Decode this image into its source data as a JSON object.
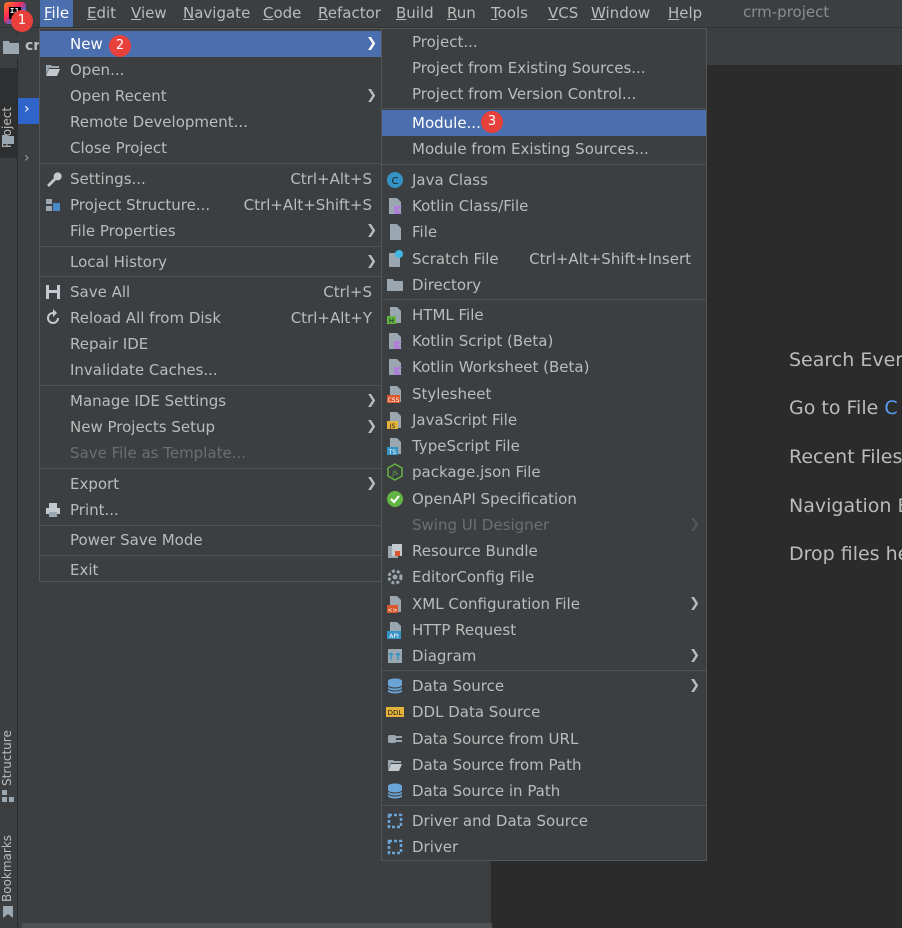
{
  "window": {
    "title": "crm-project",
    "project_short": "crm"
  },
  "menubar": [
    {
      "label": "File",
      "u": "F",
      "rest": "ile"
    },
    {
      "label": "Edit",
      "u": "E",
      "rest": "dit"
    },
    {
      "label": "View",
      "u": "V",
      "rest": "iew"
    },
    {
      "label": "Navigate",
      "u": "N",
      "rest": "avigate"
    },
    {
      "label": "Code",
      "u": "C",
      "rest": "ode"
    },
    {
      "label": "Refactor",
      "u": "R",
      "rest": "efactor"
    },
    {
      "label": "Build",
      "u": "B",
      "rest": "uild"
    },
    {
      "label": "Run",
      "u": "R",
      "rest": "un"
    },
    {
      "label": "Tools",
      "u": "T",
      "rest": "ools"
    },
    {
      "label": "VCS",
      "u": "V",
      "rest": "CS"
    },
    {
      "label": "Window",
      "u": "W",
      "rest": "indow"
    },
    {
      "label": "Help",
      "u": "H",
      "rest": "elp"
    }
  ],
  "badges": [
    "1",
    "2",
    "3"
  ],
  "left_tabs": {
    "project": "Project",
    "structure": "Structure",
    "bookmarks": "Bookmarks"
  },
  "file_menu": [
    {
      "label": "New",
      "icon": "",
      "arrow": true
    },
    {
      "label": "Open...",
      "icon": "folder-open-icon"
    },
    {
      "label": "Open Recent",
      "arrow": true
    },
    {
      "label": "Remote Development..."
    },
    {
      "label": "Close Project"
    },
    {
      "label": "Settings...",
      "icon": "wrench-icon",
      "shortcut": "Ctrl+Alt+S"
    },
    {
      "label": "Project Structure...",
      "icon": "project-structure-icon",
      "shortcut": "Ctrl+Alt+Shift+S"
    },
    {
      "label": "File Properties",
      "arrow": true
    },
    {
      "label": "Local History",
      "arrow": true
    },
    {
      "label": "Save All",
      "icon": "save-icon",
      "shortcut": "Ctrl+S"
    },
    {
      "label": "Reload All from Disk",
      "icon": "reload-icon",
      "shortcut": "Ctrl+Alt+Y"
    },
    {
      "label": "Repair IDE"
    },
    {
      "label": "Invalidate Caches..."
    },
    {
      "label": "Manage IDE Settings",
      "arrow": true
    },
    {
      "label": "New Projects Setup",
      "arrow": true
    },
    {
      "label": "Save File as Template...",
      "disabled": true
    },
    {
      "label": "Export",
      "arrow": true
    },
    {
      "label": "Print...",
      "icon": "print-icon"
    },
    {
      "label": "Power Save Mode"
    },
    {
      "label": "Exit"
    }
  ],
  "new_menu": [
    {
      "label": "Project..."
    },
    {
      "label": "Project from Existing Sources..."
    },
    {
      "label": "Project from Version Control..."
    },
    {
      "label": "Module..."
    },
    {
      "label": "Module from Existing Sources..."
    },
    {
      "label": "Java Class",
      "icon": "java-class-icon"
    },
    {
      "label": "Kotlin Class/File",
      "icon": "kotlin-file-icon"
    },
    {
      "label": "File",
      "icon": "file-icon"
    },
    {
      "label": "Scratch File",
      "icon": "scratch-file-icon",
      "shortcut": "Ctrl+Alt+Shift+Insert"
    },
    {
      "label": "Directory",
      "icon": "folder-icon"
    },
    {
      "label": "HTML File",
      "icon": "html-file-icon"
    },
    {
      "label": "Kotlin Script (Beta)",
      "icon": "kotlin-script-icon"
    },
    {
      "label": "Kotlin Worksheet (Beta)",
      "icon": "kotlin-worksheet-icon"
    },
    {
      "label": "Stylesheet",
      "icon": "css-file-icon"
    },
    {
      "label": "JavaScript File",
      "icon": "js-file-icon"
    },
    {
      "label": "TypeScript File",
      "icon": "ts-file-icon"
    },
    {
      "label": "package.json File",
      "icon": "nodejs-icon"
    },
    {
      "label": "OpenAPI Specification",
      "icon": "openapi-icon"
    },
    {
      "label": "Swing UI Designer",
      "disabled": true,
      "arrow": true
    },
    {
      "label": "Resource Bundle",
      "icon": "resource-bundle-icon"
    },
    {
      "label": "EditorConfig File",
      "icon": "gear-icon"
    },
    {
      "label": "XML Configuration File",
      "icon": "xml-file-icon",
      "arrow": true
    },
    {
      "label": "HTTP Request",
      "icon": "api-icon"
    },
    {
      "label": "Diagram",
      "icon": "diagram-icon",
      "arrow": true
    },
    {
      "label": "Data Source",
      "icon": "database-icon",
      "arrow": true
    },
    {
      "label": "DDL Data Source",
      "icon": "ddl-icon"
    },
    {
      "label": "Data Source from URL",
      "icon": "url-connector-icon"
    },
    {
      "label": "Data Source from Path",
      "icon": "folder-open-icon"
    },
    {
      "label": "Data Source in Path",
      "icon": "database-icon"
    },
    {
      "label": "Driver and Data Source",
      "icon": "driver-icon"
    },
    {
      "label": "Driver",
      "icon": "driver-icon"
    }
  ],
  "editor_hints": [
    {
      "text": "Search Every",
      "accent": ""
    },
    {
      "text": "Go to File ",
      "accent": "C"
    },
    {
      "text": "Recent Files",
      "accent": ""
    },
    {
      "text": "Navigation B",
      "accent": ""
    },
    {
      "text": "Drop files he",
      "accent": ""
    }
  ],
  "colors": {
    "highlight": "#4b6eaf",
    "menu_bg": "#3c3f41",
    "badge": "#e8413b",
    "accent": "#589df6"
  }
}
